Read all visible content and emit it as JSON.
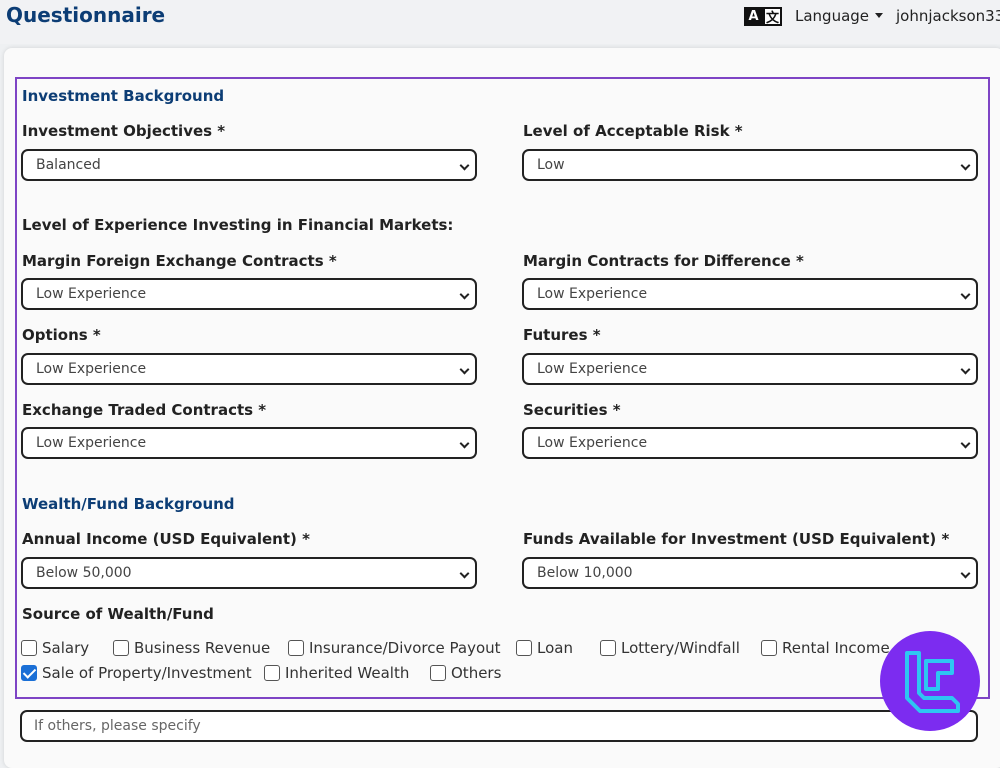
{
  "header": {
    "title": "Questionnaire",
    "language_label": "Language",
    "username": "johnjackson33",
    "language_icon_glyphs": [
      "A",
      "文"
    ]
  },
  "investment": {
    "section_title": "Investment Background",
    "objectives_label": "Investment Objectives *",
    "objectives_value": "Balanced",
    "risk_label": "Level of Acceptable Risk *",
    "risk_value": "Low",
    "experience_heading": "Level of Experience Investing in Financial Markets:",
    "fx_label": "Margin Foreign Exchange Contracts *",
    "fx_value": "Low Experience",
    "cfd_label": "Margin Contracts for Difference *",
    "cfd_value": "Low Experience",
    "options_label": "Options *",
    "options_value": "Low Experience",
    "futures_label": "Futures *",
    "futures_value": "Low Experience",
    "etc_label": "Exchange Traded Contracts *",
    "etc_value": "Low Experience",
    "securities_label": "Securities *",
    "securities_value": "Low Experience"
  },
  "wealth": {
    "section_title": "Wealth/Fund Background",
    "income_label": "Annual Income (USD Equivalent) *",
    "income_value": "Below 50,000",
    "funds_label": "Funds Available for Investment (USD Equivalent) *",
    "funds_value": "Below 10,000",
    "source_label": "Source of Wealth/Fund",
    "sources": [
      {
        "label": "Salary",
        "checked": false
      },
      {
        "label": "Business Revenue",
        "checked": false
      },
      {
        "label": "Insurance/Divorce Payout",
        "checked": false
      },
      {
        "label": "Loan",
        "checked": false
      },
      {
        "label": "Lottery/Windfall",
        "checked": false
      },
      {
        "label": "Rental Income",
        "checked": false
      },
      {
        "label": "Sale of Property/Investment",
        "checked": true
      },
      {
        "label": "Inherited Wealth",
        "checked": false
      },
      {
        "label": "Others",
        "checked": false
      }
    ],
    "other_placeholder": "If others, please specify"
  },
  "colors": {
    "title_blue": "#0c3d75",
    "frame_purple": "#7e44c5",
    "checkbox_blue": "#1a6fd6",
    "logo_purple": "#7c2cf0",
    "logo_cyan": "#2ec6f2"
  }
}
